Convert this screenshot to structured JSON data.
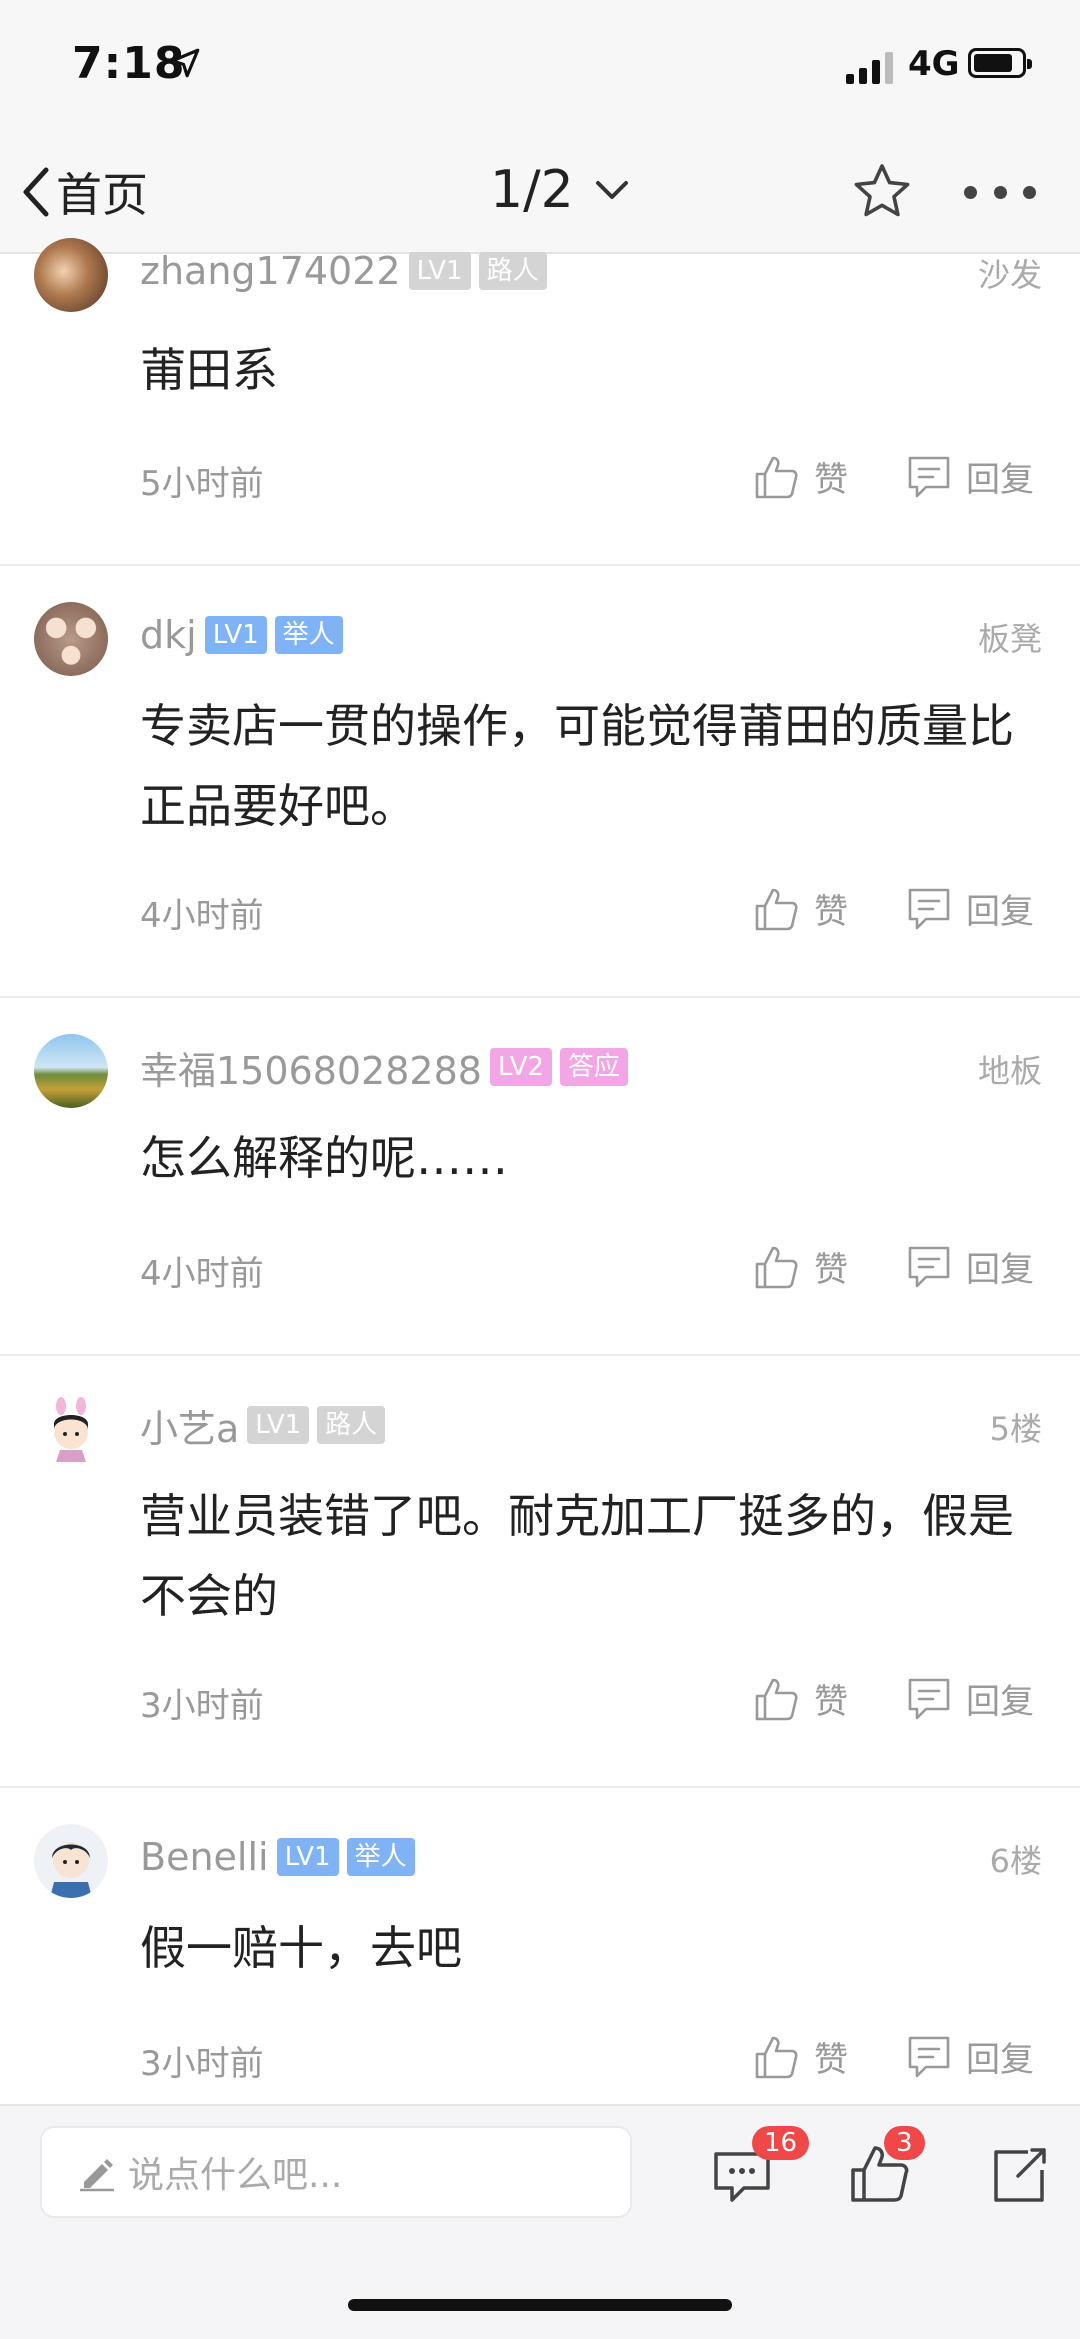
{
  "status_bar": {
    "time": "7:18",
    "network": "4G"
  },
  "nav": {
    "back_label": "首页",
    "page_indicator": "1/2"
  },
  "actions": {
    "like_label": "赞",
    "reply_label": "回复"
  },
  "comments": [
    {
      "username": "zhang174022",
      "level": "LV1",
      "rank": "路人",
      "floor": "沙发",
      "text": "莆田系",
      "time": "5小时前"
    },
    {
      "username": "dkj",
      "level": "LV1",
      "rank": "举人",
      "floor": "板凳",
      "text": "专卖店一贯的操作，可能觉得莆田的质量比正品要好吧。",
      "time": "4小时前"
    },
    {
      "username": "幸福15068028288",
      "level": "LV2",
      "rank": "答应",
      "floor": "地板",
      "text": "怎么解释的呢……",
      "time": "4小时前"
    },
    {
      "username": "小艺a",
      "level": "LV1",
      "rank": "路人",
      "floor": "5楼",
      "text": "营业员装错了吧。耐克加工厂挺多的，假是不会的",
      "time": "3小时前"
    },
    {
      "username": "Benelli",
      "level": "LV1",
      "rank": "举人",
      "floor": "6楼",
      "text": "假一赔十，去吧",
      "time": "3小时前"
    }
  ],
  "bottom_bar": {
    "input_placeholder": "说点什么吧...",
    "comment_count": "16",
    "like_count": "3"
  },
  "colors": {
    "tag_gray": "#d4d4d4",
    "tag_blue": "#7fb3f5",
    "tag_pink": "#f3a6e6",
    "badge_red": "#f04848"
  }
}
